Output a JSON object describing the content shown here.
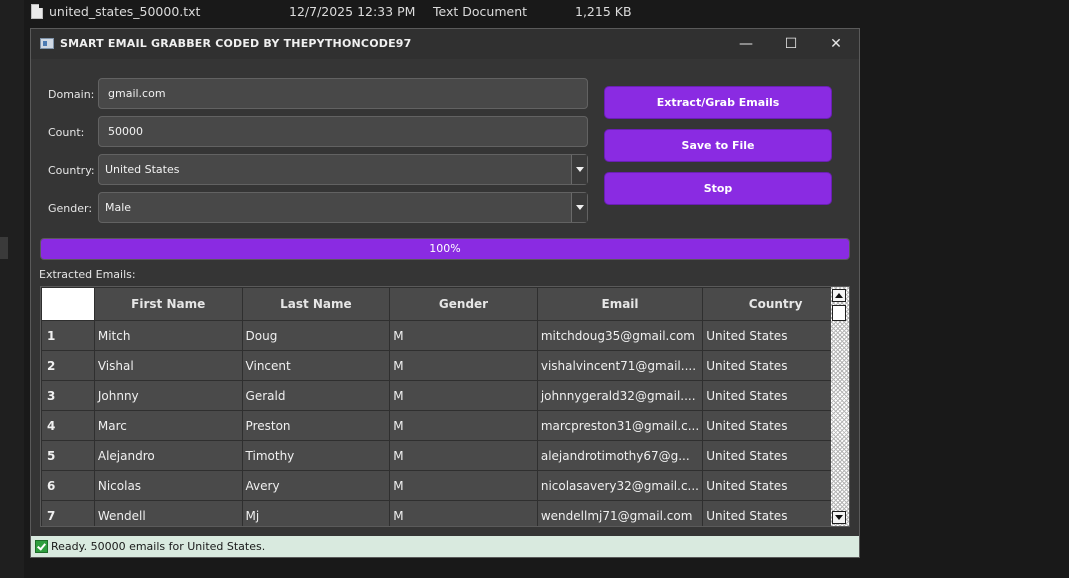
{
  "background_file": {
    "name": "united_states_50000.txt",
    "date": "12/7/2025 12:33 PM",
    "type": "Text Document",
    "size": "1,215 KB"
  },
  "window": {
    "title": "SMART EMAIL GRABBER CODED BY THEPYTHONCODE97",
    "minimize": "—",
    "maximize": "☐",
    "close": "✕"
  },
  "form": {
    "domain_label": "Domain:",
    "domain_value": "gmail.com",
    "count_label": "Count:",
    "count_value": "50000",
    "country_label": "Country:",
    "country_value": "United States",
    "gender_label": "Gender:",
    "gender_value": "Male"
  },
  "buttons": {
    "extract": "Extract/Grab Emails",
    "save": "Save to File",
    "stop": "Stop"
  },
  "progress": {
    "value": 100,
    "text": "100%"
  },
  "table": {
    "label": "Extracted Emails:",
    "headers": [
      "First Name",
      "Last Name",
      "Gender",
      "Email",
      "Country"
    ],
    "rows": [
      [
        "1",
        "Mitch",
        "Doug",
        "M",
        "mitchdoug35@gmail.com",
        "United States"
      ],
      [
        "2",
        "Vishal",
        "Vincent",
        "M",
        "vishalvincent71@gmail....",
        "United States"
      ],
      [
        "3",
        "Johnny",
        "Gerald",
        "M",
        "johnnygerald32@gmail....",
        "United States"
      ],
      [
        "4",
        "Marc",
        "Preston",
        "M",
        "marcpreston31@gmail.c...",
        "United States"
      ],
      [
        "5",
        "Alejandro",
        "Timothy",
        "M",
        "alejandrotimothy67@g...",
        "United States"
      ],
      [
        "6",
        "Nicolas",
        "Avery",
        "M",
        "nicolasavery32@gmail.c...",
        "United States"
      ],
      [
        "7",
        "Wendell",
        "Mj",
        "M",
        "wendellmj71@gmail.com",
        "United States"
      ]
    ]
  },
  "status": {
    "text": "Ready. 50000 emails for United States.",
    "color": "#d9eadf"
  },
  "colors": {
    "accent": "#8a2be2",
    "window_bg": "#353535"
  }
}
